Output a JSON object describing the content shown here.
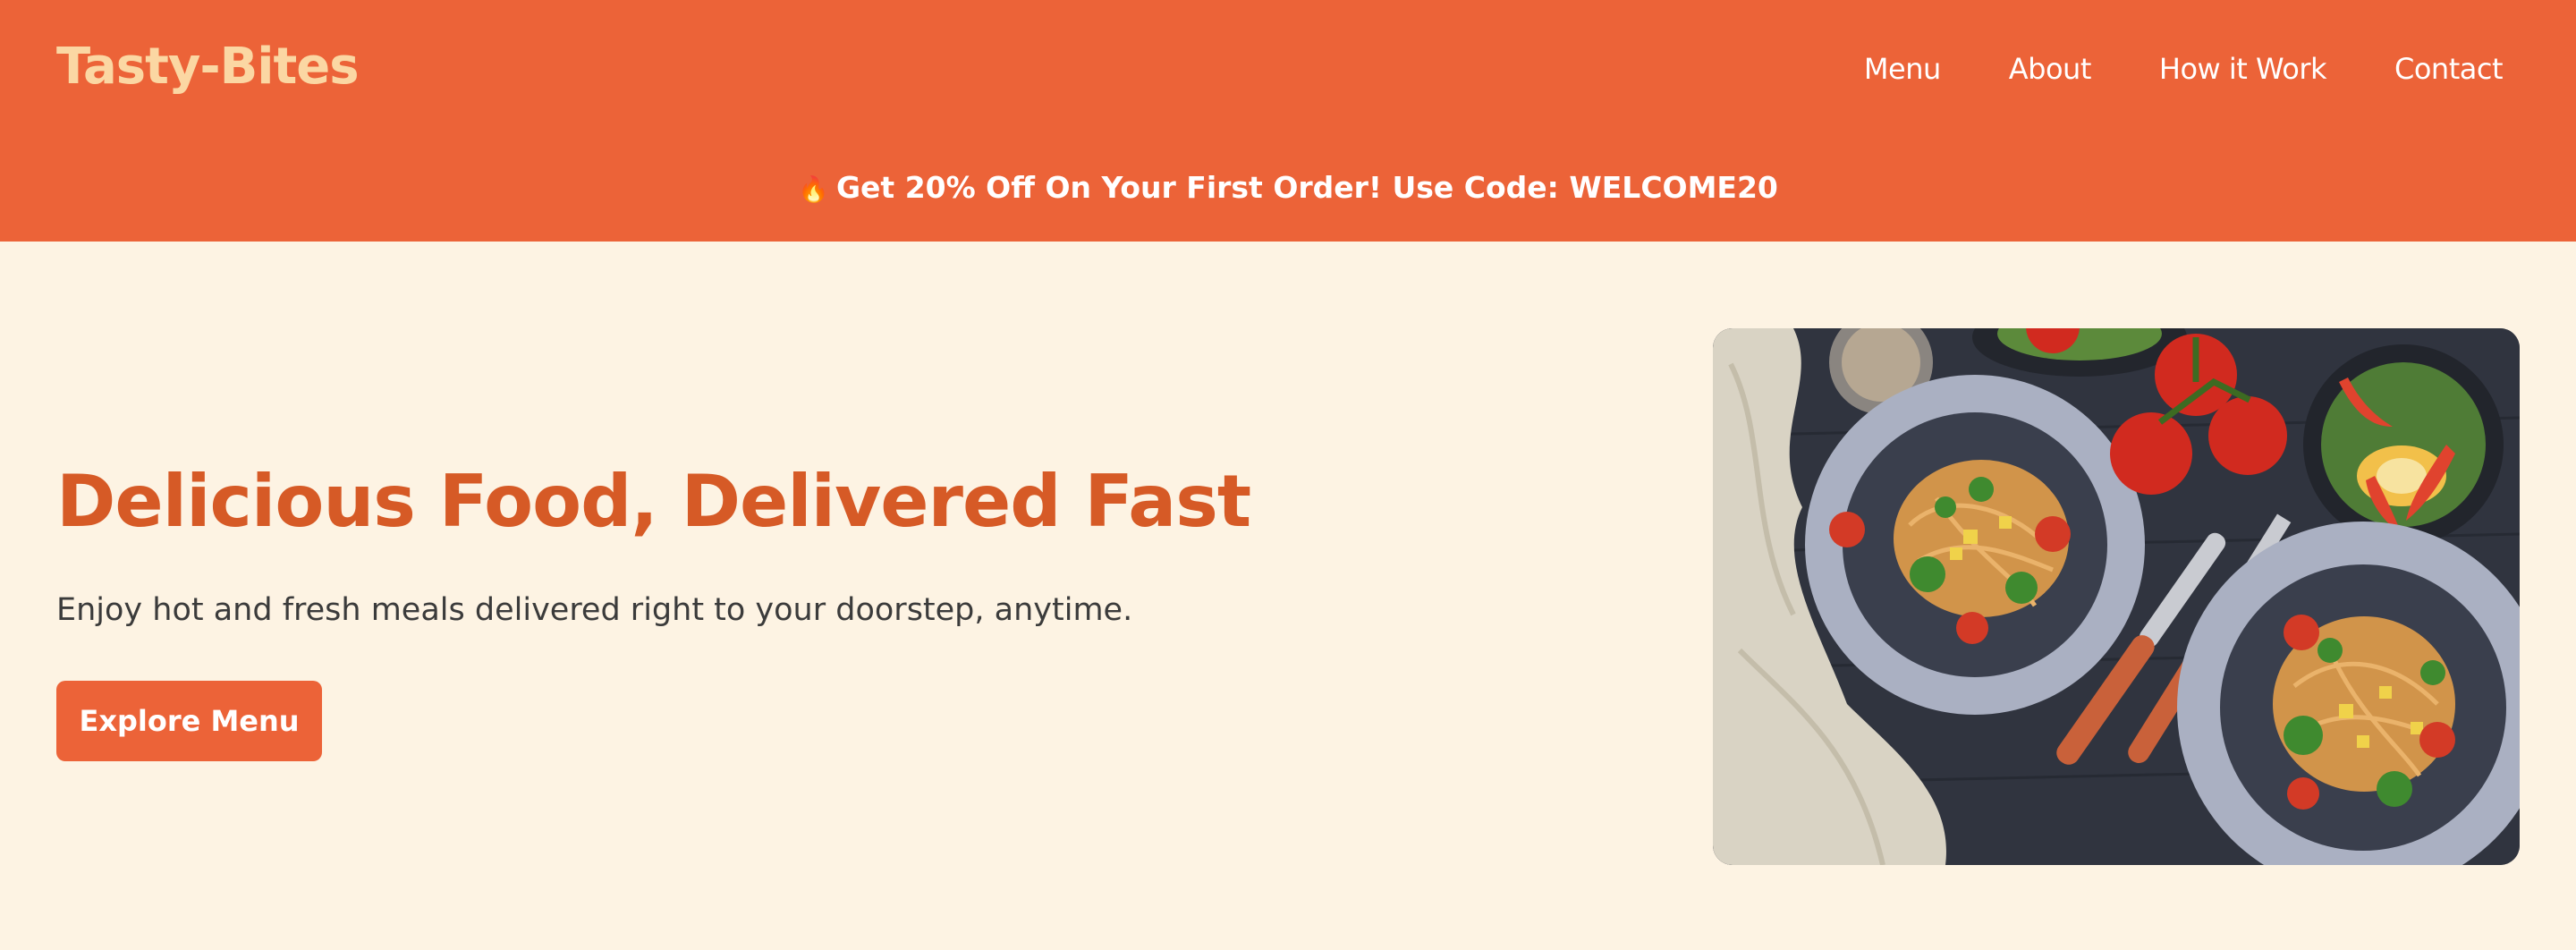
{
  "header": {
    "logo": "Tasty-Bites",
    "nav": [
      "Menu",
      "About",
      "How it Work",
      "Contact"
    ]
  },
  "promo": {
    "icon": "fire-icon",
    "text": "Get 20% Off On Your First Order! Use Code: WELCOME20"
  },
  "hero": {
    "title": "Delicious Food, Delivered Fast",
    "subtitle": "Enjoy hot and fresh meals delivered right to your doorstep, anytime.",
    "cta_label": "Explore Menu"
  },
  "colors": {
    "header_bg": "#ec6338",
    "logo": "#fbd7a3",
    "page_bg": "#fdf3e3",
    "title": "#d65a26",
    "button": "#ec6338"
  }
}
